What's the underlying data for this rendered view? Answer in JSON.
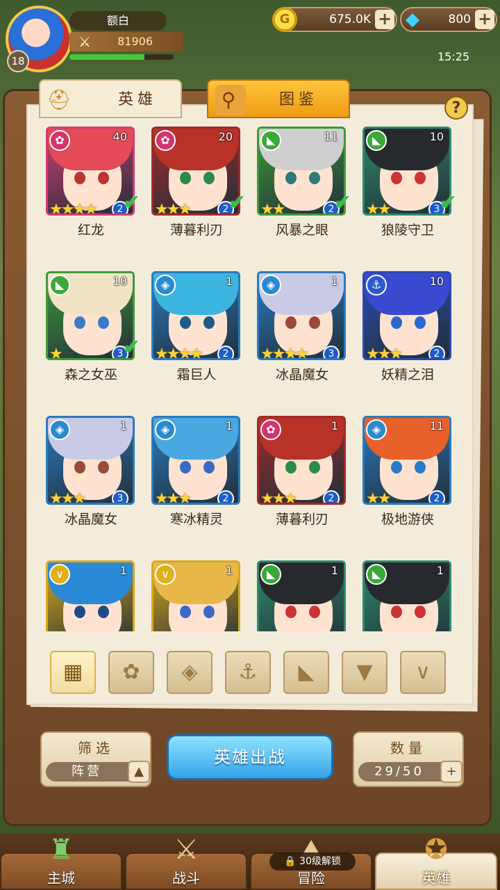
{
  "player": {
    "name": "额白",
    "level": "18",
    "power": "81906",
    "xp_fraction": 0.72
  },
  "currency": {
    "gold": "675.0K",
    "gems": "800",
    "plus": "+"
  },
  "clock": "15:25",
  "tabs": {
    "heroes": "英雄",
    "codex": "图鉴"
  },
  "help": "?",
  "heroes": [
    {
      "name": "红龙",
      "level": "40",
      "rank": "2",
      "stars": "★★★★",
      "faction": "dragon",
      "checked": true,
      "hair": "#e44a57",
      "eye": "#b33",
      "frame": "#d23c70"
    },
    {
      "name": "薄暮利刃",
      "level": "20",
      "rank": "2",
      "stars": "★★★",
      "faction": "dragon",
      "checked": true,
      "hair": "#b8322a",
      "eye": "#2b8a4a",
      "frame": "#a12a2a"
    },
    {
      "name": "风暴之眼",
      "level": "11",
      "rank": "2",
      "stars": "★★",
      "faction": "beast",
      "checked": true,
      "hair": "#cfcfcf",
      "eye": "#2f7a7a",
      "frame": "#3f9a3a"
    },
    {
      "name": "狼陵守卫",
      "level": "10",
      "rank": "3",
      "stars": "★★",
      "faction": "beast",
      "checked": true,
      "hair": "#262a2e",
      "eye": "#c33",
      "frame": "#2f8a6a"
    },
    {
      "name": "森之女巫",
      "level": "10",
      "rank": "3",
      "stars": "★",
      "faction": "beast",
      "checked": true,
      "hair": "#f1e4c6",
      "eye": "#3a7ac8",
      "frame": "#3f9a3a"
    },
    {
      "name": "霜巨人",
      "level": "1",
      "rank": "2",
      "stars": "★★★★",
      "faction": "frost",
      "checked": false,
      "hair": "#3cb5e0",
      "eye": "#1f5a8a",
      "frame": "#2a7ac0"
    },
    {
      "name": "冰晶魔女",
      "level": "1",
      "rank": "3",
      "stars": "★★★★",
      "faction": "frost",
      "checked": false,
      "hair": "#c9cbe6",
      "eye": "#9a4a3a",
      "frame": "#2a7ac0"
    },
    {
      "name": "妖精之泪",
      "level": "10",
      "rank": "2",
      "stars": "★★★",
      "faction": "sea",
      "checked": false,
      "hair": "#3a4ad0",
      "eye": "#2a6ad0",
      "frame": "#2a4ab0"
    },
    {
      "name": "冰晶魔女",
      "level": "1",
      "rank": "3",
      "stars": "★★★",
      "faction": "frost",
      "checked": false,
      "hair": "#c9cbe6",
      "eye": "#9a4a3a",
      "frame": "#2a7ac0"
    },
    {
      "name": "寒冰精灵",
      "level": "1",
      "rank": "2",
      "stars": "★★★",
      "faction": "frost",
      "checked": false,
      "hair": "#4aa8e0",
      "eye": "#3a6ac8",
      "frame": "#2a7ac0"
    },
    {
      "name": "薄暮利刃",
      "level": "1",
      "rank": "2",
      "stars": "★★★",
      "faction": "dragon",
      "checked": false,
      "hair": "#b8322a",
      "eye": "#2b8a4a",
      "frame": "#a12a2a"
    },
    {
      "name": "极地游侠",
      "level": "11",
      "rank": "2",
      "stars": "★★",
      "faction": "frost",
      "checked": false,
      "hair": "#e8602a",
      "eye": "#2a7ac8",
      "frame": "#2a7ac0"
    },
    {
      "name": "",
      "level": "1",
      "rank": "",
      "stars": "",
      "faction": "holy",
      "checked": false,
      "hair": "#2a8ad8",
      "eye": "#1f4a8a",
      "frame": "#d8a81a"
    },
    {
      "name": "",
      "level": "1",
      "rank": "",
      "stars": "",
      "faction": "holy",
      "checked": false,
      "hair": "#e8b84a",
      "eye": "#3a6ac8",
      "frame": "#d8a81a"
    },
    {
      "name": "",
      "level": "1",
      "rank": "",
      "stars": "",
      "faction": "beast",
      "checked": false,
      "hair": "#262a2e",
      "eye": "#c33",
      "frame": "#2f8a6a"
    },
    {
      "name": "",
      "level": "1",
      "rank": "",
      "stars": "",
      "faction": "beast",
      "checked": false,
      "hair": "#262a2e",
      "eye": "#c33",
      "frame": "#2f8a6a"
    }
  ],
  "faction_colors": {
    "dragon": "#d6336e",
    "beast": "#3ca83a",
    "frost": "#2a8ad0",
    "sea": "#2a5ad0",
    "holy": "#e0b01a"
  },
  "faction_glyphs": {
    "dragon": "✿",
    "beast": "◣",
    "frost": "◈",
    "sea": "⚓",
    "holy": "∨"
  },
  "filters": [
    {
      "icon": "grid-icon",
      "glyph": "▦",
      "active": true
    },
    {
      "icon": "dragon-faction-icon",
      "glyph": "✿",
      "active": false
    },
    {
      "icon": "frost-faction-icon",
      "glyph": "◈",
      "active": false
    },
    {
      "icon": "anchor-faction-icon",
      "glyph": "⚓",
      "active": false
    },
    {
      "icon": "beast-faction-icon",
      "glyph": "◣",
      "active": false
    },
    {
      "icon": "shadow-faction-icon",
      "glyph": "▼",
      "active": false
    },
    {
      "icon": "holy-faction-icon",
      "glyph": "∨",
      "active": false
    }
  ],
  "filter_box": {
    "title": "筛选",
    "value": "阵营",
    "arrow": "▲"
  },
  "deploy": "英雄出战",
  "count_box": {
    "title": "数量",
    "value": "29/50",
    "plus": "+"
  },
  "nav": {
    "main_city": "主城",
    "battle": "战斗",
    "adventure": "冒险",
    "adventure_lock": "30级解锁",
    "heroes": "英雄"
  }
}
